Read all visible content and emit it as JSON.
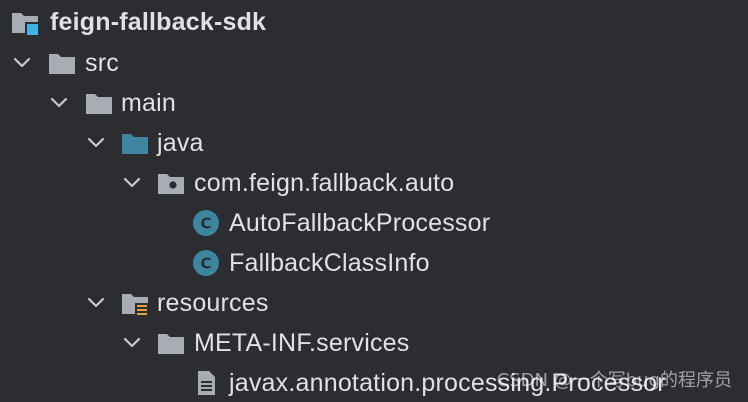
{
  "project_tree": {
    "root": {
      "label": "feign-fallback-sdk",
      "icon": "module-folder-icon"
    },
    "src": {
      "label": "src",
      "icon": "folder-icon",
      "expanded": true
    },
    "main": {
      "label": "main",
      "icon": "folder-icon",
      "expanded": true
    },
    "java": {
      "label": "java",
      "icon": "source-root-folder-icon",
      "expanded": true
    },
    "package": {
      "label": "com.feign.fallback.auto",
      "icon": "package-icon",
      "expanded": true
    },
    "class_1": {
      "label": "AutoFallbackProcessor",
      "icon": "class-icon"
    },
    "class_2": {
      "label": "FallbackClassInfo",
      "icon": "class-icon"
    },
    "resources": {
      "label": "resources",
      "icon": "resources-folder-icon",
      "expanded": true
    },
    "meta_inf": {
      "label": "META-INF.services",
      "icon": "folder-icon",
      "expanded": true
    },
    "service_file": {
      "label": "javax.annotation.processing.Processor",
      "icon": "text-file-icon"
    }
  },
  "watermark": {
    "text": "CSDN @一个写bug的程序员"
  },
  "colors": {
    "background": "#2b2d30",
    "text": "#dfe1e5",
    "folder": "#a8adb4",
    "source_root": "#3e86a0",
    "class_badge": "#3e86a0",
    "module_badge": "#3fb3e8"
  }
}
